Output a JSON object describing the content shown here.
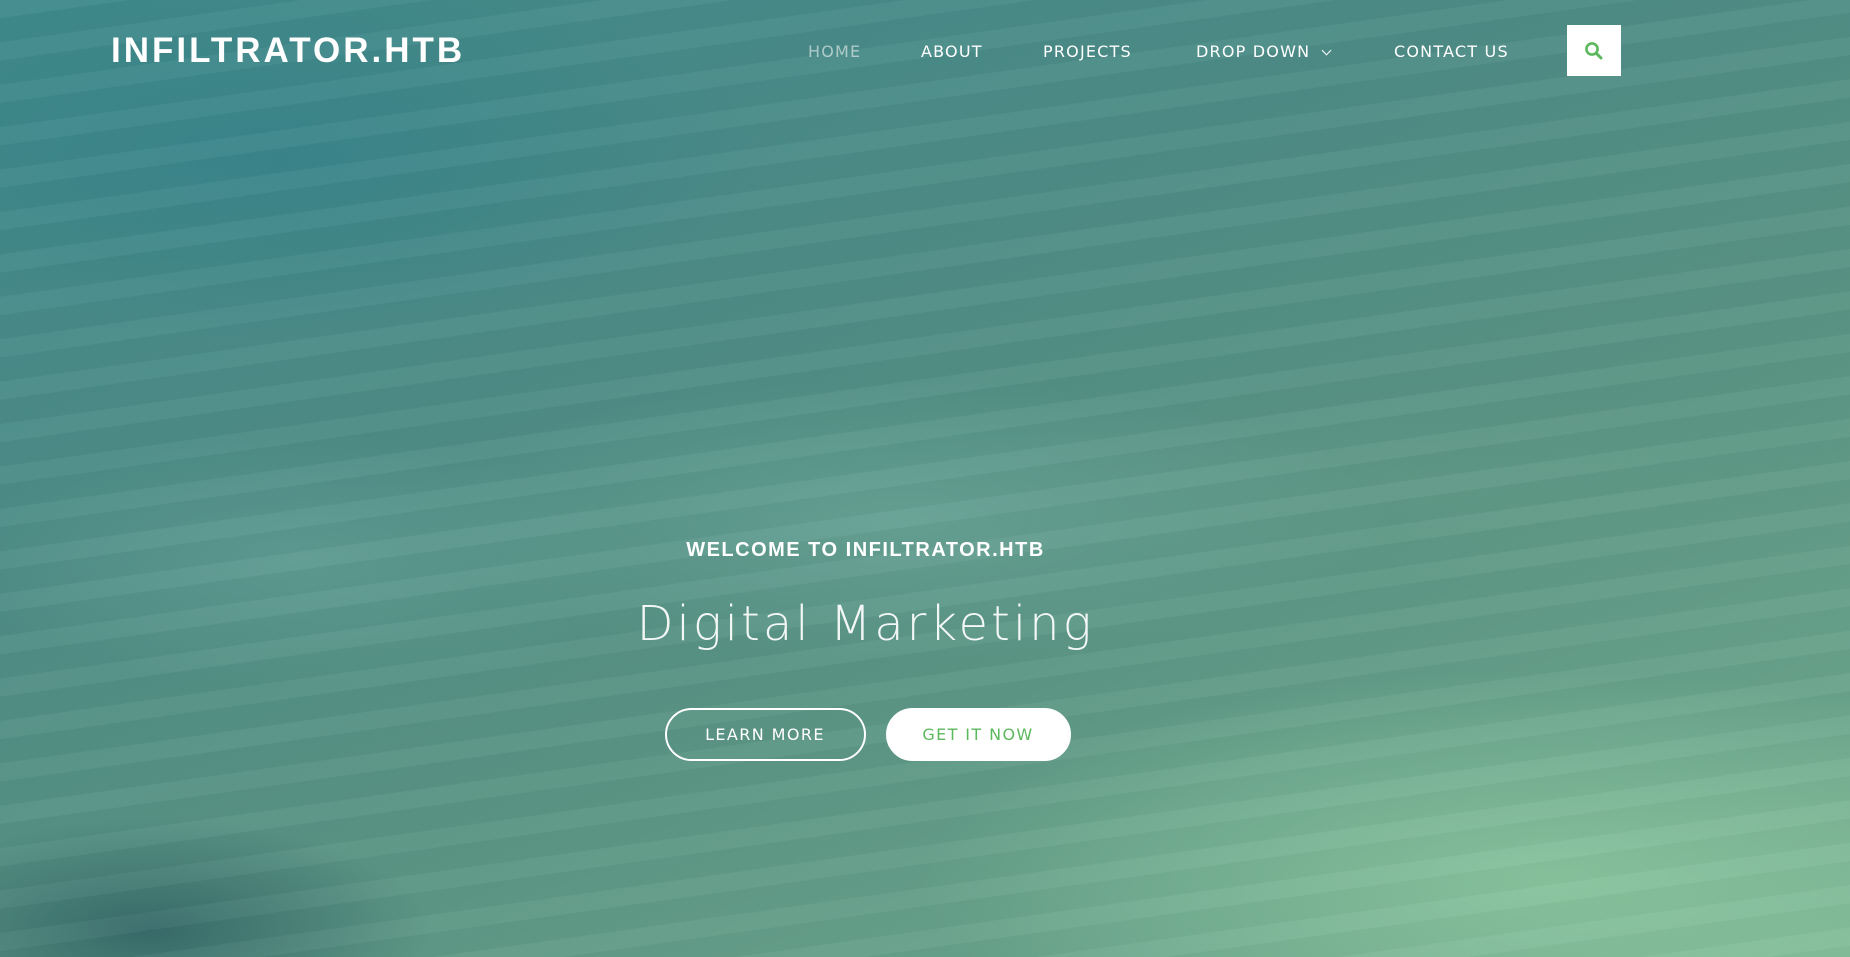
{
  "header": {
    "logo": "INFILTRATOR.HTB",
    "nav": [
      {
        "label": "HOME",
        "active": true
      },
      {
        "label": "ABOUT",
        "active": false
      },
      {
        "label": "PROJECTS",
        "active": false
      },
      {
        "label": "DROP DOWN",
        "active": false,
        "has_dropdown": true
      },
      {
        "label": "CONTACT US",
        "active": false
      }
    ],
    "search_icon": "search-icon"
  },
  "hero": {
    "kicker": "WELCOME TO INFILTRATOR.HTB",
    "title": "Digital Marketing",
    "buttons": {
      "learn_more": "LEARN MORE",
      "get_it_now": "GET IT NOW"
    }
  },
  "colors": {
    "accent": "#5cb85c",
    "text": "#ffffff",
    "background": "#4e8c86"
  }
}
